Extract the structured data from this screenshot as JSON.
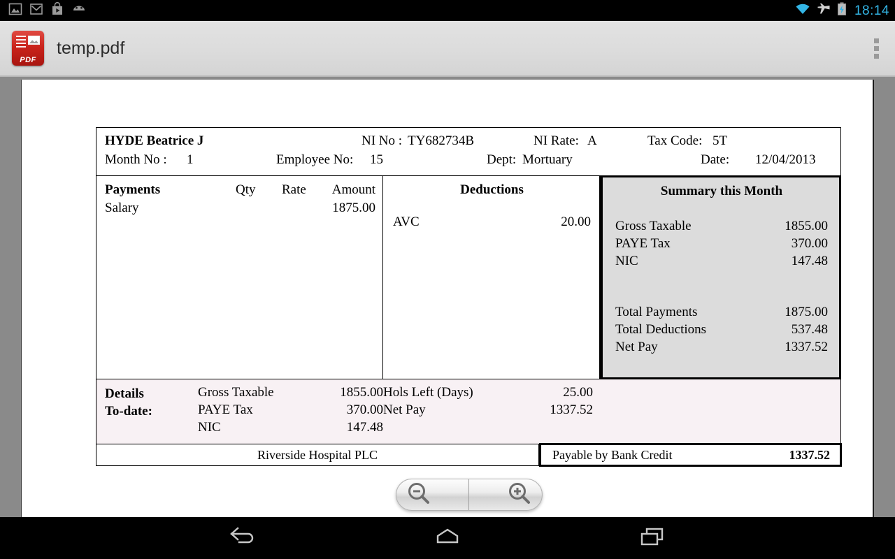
{
  "status_bar": {
    "notification_icons": [
      "image-icon",
      "mail-icon",
      "play-store-icon",
      "android-icon"
    ],
    "system_icons": [
      "wifi-icon",
      "airplane-mode-icon",
      "battery-charging-icon"
    ],
    "clock": "18:14",
    "clock_color": "#33b5e5"
  },
  "action_bar": {
    "app_icon": "pdf-file-icon",
    "app_icon_label": "PDF",
    "title": "temp.pdf",
    "overflow_icon": "overflow-menu-icon"
  },
  "payslip": {
    "header": {
      "employee_name": "HYDE Beatrice J",
      "ni_no_label": "NI No :",
      "ni_no_value": "TY682734B",
      "ni_rate_label": "NI Rate:",
      "ni_rate_value": "A",
      "tax_code_label": "Tax Code:",
      "tax_code_value": "5T",
      "month_no_label": "Month No :",
      "month_no_value": "1",
      "employee_no_label": "Employee No:",
      "employee_no_value": "15",
      "dept_label": "Dept:",
      "dept_value": "Mortuary",
      "date_label": "Date:",
      "date_value": "12/04/2013"
    },
    "payments": {
      "title": "Payments",
      "columns": [
        "Qty",
        "Rate",
        "Amount"
      ],
      "rows": [
        {
          "label": "Salary",
          "qty": "",
          "rate": "",
          "amount": "1875.00"
        }
      ]
    },
    "deductions": {
      "title": "Deductions",
      "rows": [
        {
          "label": "AVC",
          "amount": "20.00"
        }
      ]
    },
    "summary": {
      "title": "Summary this Month",
      "rows_top": [
        {
          "label": "Gross Taxable",
          "value": "1855.00"
        },
        {
          "label": "PAYE Tax",
          "value": "370.00"
        },
        {
          "label": "NIC",
          "value": "147.48"
        }
      ],
      "rows_bottom": [
        {
          "label": "Total Payments",
          "value": "1875.00"
        },
        {
          "label": "Total Deductions",
          "value": "537.48"
        },
        {
          "label": "Net Pay",
          "value": "1337.52"
        }
      ],
      "background": "#dcdcdc"
    },
    "details": {
      "label_line1": "Details",
      "label_line2": "To-date:",
      "column_left": [
        {
          "label": "Gross Taxable",
          "value": "1855.00"
        },
        {
          "label": "PAYE Tax",
          "value": "370.00"
        },
        {
          "label": "NIC",
          "value": "147.48"
        }
      ],
      "column_right": [
        {
          "label": "Hols Left (Days)",
          "value": "25.00"
        },
        {
          "label": "Net Pay",
          "value": "1337.52"
        }
      ],
      "background": "#f8f1f4"
    },
    "footer": {
      "company": "Riverside Hospital PLC",
      "payable_label": "Payable by Bank Credit",
      "payable_value": "1337.52"
    }
  },
  "zoom_controls": {
    "zoom_out_icon": "zoom-out-icon",
    "zoom_in_icon": "zoom-in-icon"
  },
  "nav_bar": {
    "back_icon": "back-icon",
    "home_icon": "home-icon",
    "recents_icon": "recent-apps-icon"
  }
}
